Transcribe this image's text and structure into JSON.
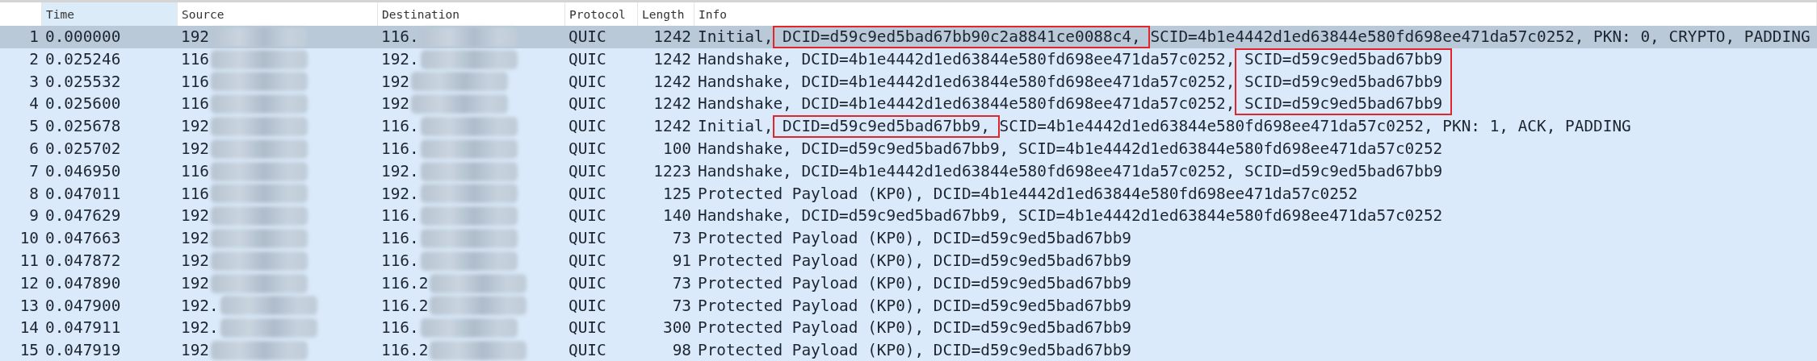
{
  "columns": [
    {
      "selected": false
    },
    {
      "label": "Time",
      "selected": true
    },
    {
      "label": "Source",
      "selected": false
    },
    {
      "label": "Destination",
      "selected": false
    },
    {
      "label": "Protocol",
      "selected": false
    },
    {
      "label": "Length",
      "selected": false
    },
    {
      "label": "Info",
      "selected": false
    }
  ],
  "rows": [
    {
      "no": "1",
      "time": "0.000000",
      "source": "192",
      "destination": "116.",
      "protocol": "QUIC",
      "length": "1242",
      "selected": true,
      "info": [
        {
          "text": "Initial,"
        },
        {
          "text": " DCID=d59c9ed5bad67bb90c2a8841ce0088c4, ",
          "highlighted": true
        },
        {
          "text": "SCID=4b1e4442d1ed63844e580fd698ee471da57c0252, PKN: 0, CRYPTO, PADDING"
        }
      ]
    },
    {
      "no": "2",
      "time": "0.025246",
      "source": "116",
      "destination": "192.",
      "protocol": "QUIC",
      "length": "1242",
      "selected": false,
      "info": [
        {
          "text": "Handshake, DCID=4b1e4442d1ed63844e580fd698ee471da57c0252,"
        },
        {
          "text": " SCID=d59c9ed5bad67bb9 ",
          "highlighted": true
        }
      ]
    },
    {
      "no": "3",
      "time": "0.025532",
      "source": "116",
      "destination": "192",
      "protocol": "QUIC",
      "length": "1242",
      "selected": false,
      "info": [
        {
          "text": "Handshake, DCID=4b1e4442d1ed63844e580fd698ee471da57c0252,"
        },
        {
          "text": " SCID=d59c9ed5bad67bb9 ",
          "highlighted": true
        }
      ]
    },
    {
      "no": "4",
      "time": "0.025600",
      "source": "116",
      "destination": "192",
      "protocol": "QUIC",
      "length": "1242",
      "selected": false,
      "info": [
        {
          "text": "Handshake, DCID=4b1e4442d1ed63844e580fd698ee471da57c0252,"
        },
        {
          "text": " SCID=d59c9ed5bad67bb9 ",
          "highlighted": true
        }
      ]
    },
    {
      "no": "5",
      "time": "0.025678",
      "source": "192",
      "destination": "116.",
      "protocol": "QUIC",
      "length": "1242",
      "selected": false,
      "info": [
        {
          "text": "Initial,"
        },
        {
          "text": " DCID=d59c9ed5bad67bb9, ",
          "highlighted": true
        },
        {
          "text": "SCID=4b1e4442d1ed63844e580fd698ee471da57c0252, PKN: 1, ACK, PADDING"
        }
      ]
    },
    {
      "no": "6",
      "time": "0.025702",
      "source": "192",
      "destination": "116.",
      "protocol": "QUIC",
      "length": "100",
      "selected": false,
      "info": [
        {
          "text": "Handshake, DCID=d59c9ed5bad67bb9, SCID=4b1e4442d1ed63844e580fd698ee471da57c0252"
        }
      ]
    },
    {
      "no": "7",
      "time": "0.046950",
      "source": "116",
      "destination": "192.",
      "protocol": "QUIC",
      "length": "1223",
      "selected": false,
      "info": [
        {
          "text": "Handshake, DCID=4b1e4442d1ed63844e580fd698ee471da57c0252, SCID=d59c9ed5bad67bb9"
        }
      ]
    },
    {
      "no": "8",
      "time": "0.047011",
      "source": "116",
      "destination": "192.",
      "protocol": "QUIC",
      "length": "125",
      "selected": false,
      "info": [
        {
          "text": "Protected Payload (KP0), DCID=4b1e4442d1ed63844e580fd698ee471da57c0252"
        }
      ]
    },
    {
      "no": "9",
      "time": "0.047629",
      "source": "192",
      "destination": "116.",
      "protocol": "QUIC",
      "length": "140",
      "selected": false,
      "info": [
        {
          "text": "Handshake, DCID=d59c9ed5bad67bb9, SCID=4b1e4442d1ed63844e580fd698ee471da57c0252"
        }
      ]
    },
    {
      "no": "10",
      "time": "0.047663",
      "source": "192",
      "destination": "116.",
      "protocol": "QUIC",
      "length": "73",
      "selected": false,
      "info": [
        {
          "text": "Protected Payload (KP0), DCID=d59c9ed5bad67bb9"
        }
      ]
    },
    {
      "no": "11",
      "time": "0.047872",
      "source": "192",
      "destination": "116.",
      "protocol": "QUIC",
      "length": "91",
      "selected": false,
      "info": [
        {
          "text": "Protected Payload (KP0), DCID=d59c9ed5bad67bb9"
        }
      ]
    },
    {
      "no": "12",
      "time": "0.047890",
      "source": "192",
      "destination": "116.2",
      "protocol": "QUIC",
      "length": "73",
      "selected": false,
      "info": [
        {
          "text": "Protected Payload (KP0), DCID=d59c9ed5bad67bb9"
        }
      ]
    },
    {
      "no": "13",
      "time": "0.047900",
      "source": "192.",
      "destination": "116.2",
      "protocol": "QUIC",
      "length": "73",
      "selected": false,
      "info": [
        {
          "text": "Protected Payload (KP0), DCID=d59c9ed5bad67bb9"
        }
      ]
    },
    {
      "no": "14",
      "time": "0.047911",
      "source": "192.",
      "destination": "116.",
      "protocol": "QUIC",
      "length": "300",
      "selected": false,
      "info": [
        {
          "text": "Protected Payload (KP0), DCID=d59c9ed5bad67bb9"
        }
      ]
    },
    {
      "no": "15",
      "time": "0.047919",
      "source": "192",
      "destination": "116.2",
      "protocol": "QUIC",
      "length": "98",
      "selected": false,
      "info": [
        {
          "text": "Protected Payload (KP0), DCID=d59c9ed5bad67bb9"
        }
      ]
    }
  ]
}
